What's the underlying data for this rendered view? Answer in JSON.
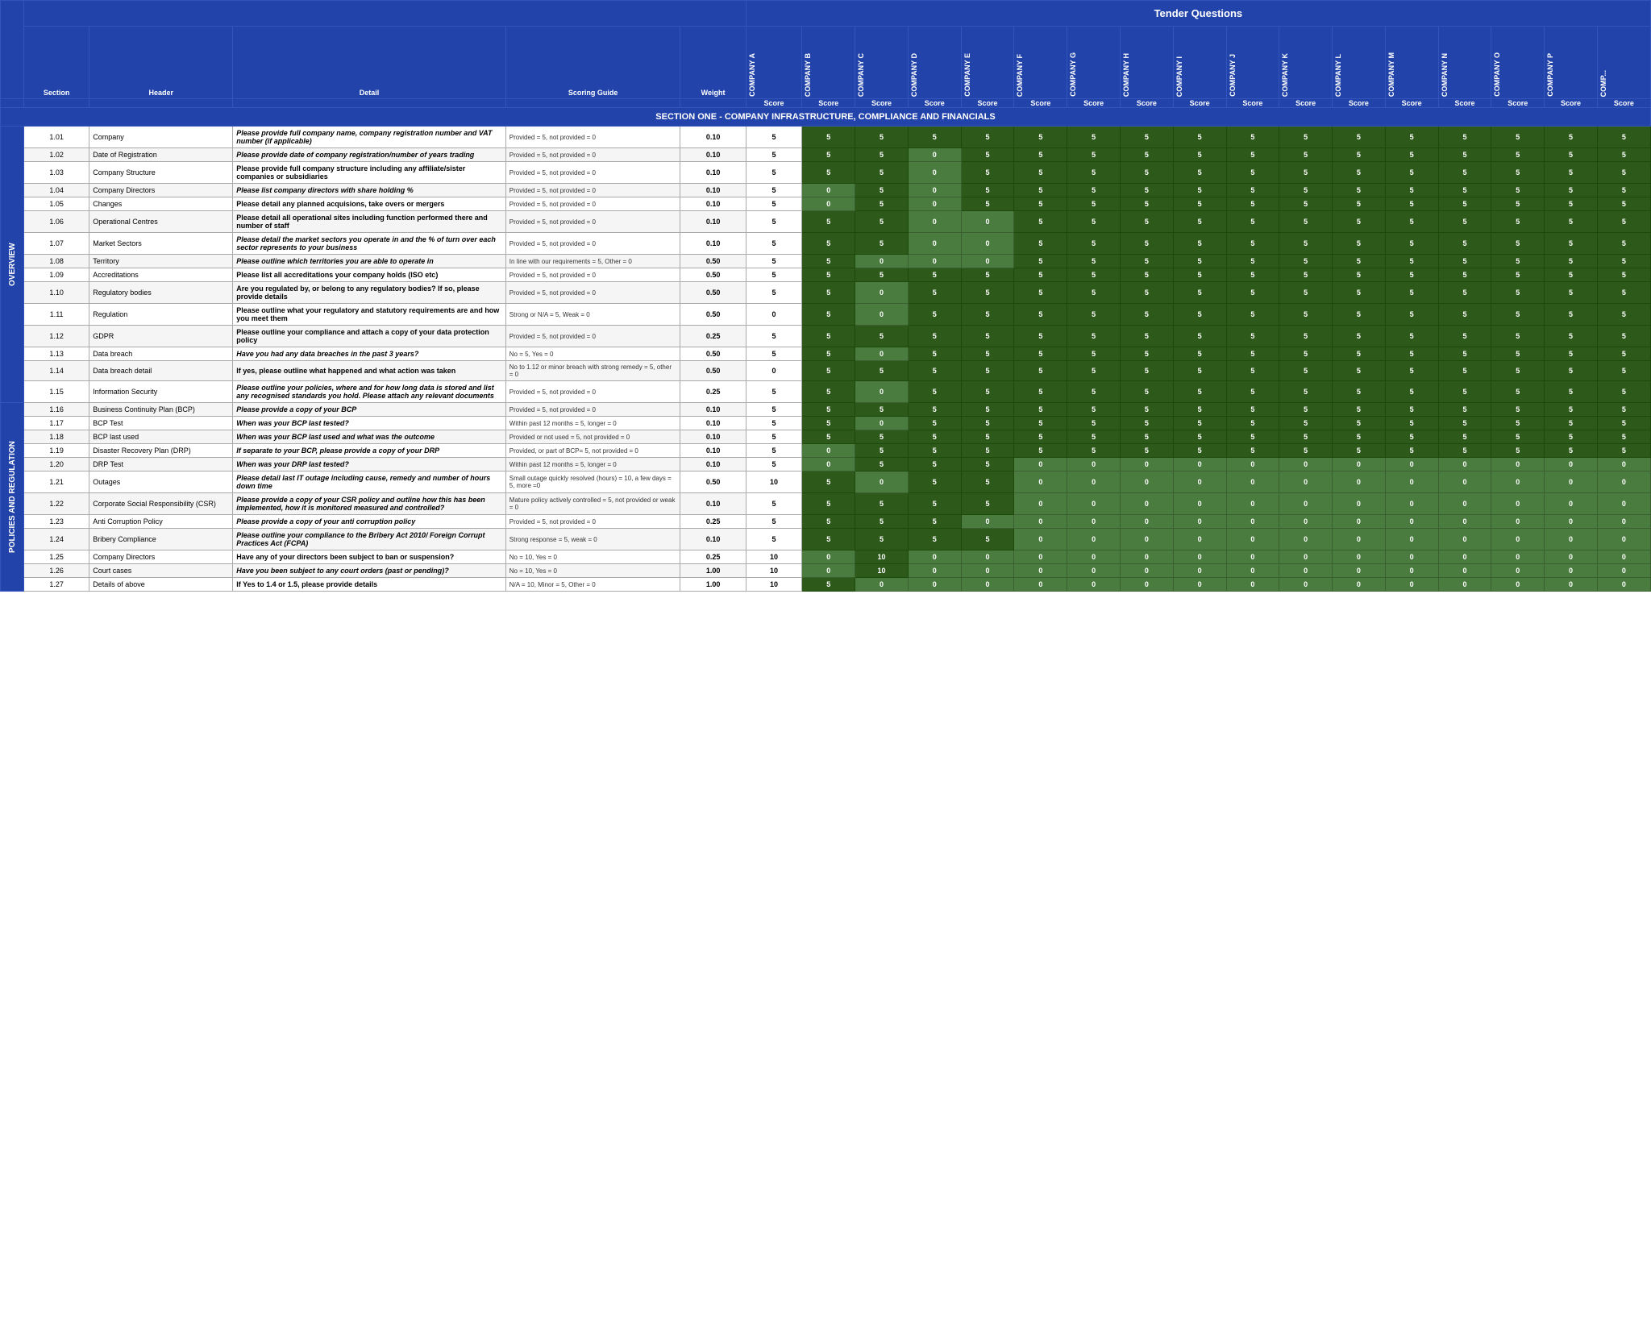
{
  "title": "Tender Questions",
  "section_header": "SECTION ONE - COMPANY INFRASTRUCTURE, COMPLIANCE AND FINANCIALS",
  "col_labels": {
    "section": "Section",
    "header": "Header",
    "detail": "Detail",
    "scoring": "Scoring Guide",
    "weight": "Weight",
    "score": "Score"
  },
  "companies": [
    "COMPANY A",
    "COMPANY B",
    "COMPANY C",
    "COMPANY D",
    "COMPANY E",
    "COMPANY F",
    "COMPANY G",
    "COMPANY H",
    "COMPANY I",
    "COMPANY J",
    "COMPANY K",
    "COMPANY L",
    "COMPANY M",
    "COMPANY N",
    "COMPANY O",
    "COMPANY P",
    "COMP..."
  ],
  "side_labels": {
    "overview": "OVERVIEW",
    "policies": "POLICIES AND REGULATION"
  },
  "rows": [
    {
      "num": "1.01",
      "header": "Company",
      "detail": "Please provide full company name, company registration number and VAT number (if applicable)",
      "scoring": "Provided = 5, not provided = 0",
      "weight": "0.10",
      "scores": [
        5,
        5,
        5,
        5,
        5,
        5,
        5,
        5,
        5,
        5,
        5,
        5,
        5,
        5,
        5,
        5,
        5
      ],
      "detail_bold": true
    },
    {
      "num": "1.02",
      "header": "Date of Registration",
      "detail": "Please provide date of company registration/number of years trading",
      "scoring": "Provided = 5, not provided = 0",
      "weight": "0.10",
      "scores": [
        5,
        5,
        5,
        0,
        5,
        5,
        5,
        5,
        5,
        5,
        5,
        5,
        5,
        5,
        5,
        5,
        5
      ],
      "detail_bold": true
    },
    {
      "num": "1.03",
      "header": "Company Structure",
      "detail": "Please provide full company structure including any affiliate/sister companies or subsidiaries",
      "scoring": "Provided = 5, not provided = 0",
      "weight": "0.10",
      "scores": [
        5,
        5,
        5,
        0,
        5,
        5,
        5,
        5,
        5,
        5,
        5,
        5,
        5,
        5,
        5,
        5,
        5
      ],
      "detail_bold": false
    },
    {
      "num": "1.04",
      "header": "Company Directors",
      "detail": "Please list company directors with share holding %",
      "scoring": "Provided = 5, not provided = 0",
      "weight": "0.10",
      "scores": [
        5,
        0,
        5,
        0,
        5,
        5,
        5,
        5,
        5,
        5,
        5,
        5,
        5,
        5,
        5,
        5,
        5
      ],
      "detail_bold": true
    },
    {
      "num": "1.05",
      "header": "Changes",
      "detail": "Please detail any planned acquisions, take overs or mergers",
      "scoring": "Provided = 5, not provided = 0",
      "weight": "0.10",
      "scores": [
        5,
        0,
        5,
        0,
        5,
        5,
        5,
        5,
        5,
        5,
        5,
        5,
        5,
        5,
        5,
        5,
        5
      ],
      "detail_bold": false
    },
    {
      "num": "1.06",
      "header": "Operational Centres",
      "detail": "Please detail all operational sites including function performed there and number of staff",
      "scoring": "Provided = 5, not provided = 0",
      "weight": "0.10",
      "scores": [
        5,
        5,
        5,
        0,
        0,
        5,
        5,
        5,
        5,
        5,
        5,
        5,
        5,
        5,
        5,
        5,
        5
      ],
      "detail_bold": false
    },
    {
      "num": "1.07",
      "header": "Market Sectors",
      "detail": "Please detail the market sectors you operate in and the % of turn over each sector represents to your business",
      "scoring": "Provided = 5, not provided = 0",
      "weight": "0.10",
      "scores": [
        5,
        5,
        5,
        0,
        0,
        5,
        5,
        5,
        5,
        5,
        5,
        5,
        5,
        5,
        5,
        5,
        5
      ],
      "detail_bold": true
    },
    {
      "num": "1.08",
      "header": "Territory",
      "detail": "Please outline which territories you are able to operate in",
      "scoring": "In line with our requirements = 5, Other = 0",
      "weight": "0.50",
      "scores": [
        5,
        5,
        0,
        0,
        0,
        5,
        5,
        5,
        5,
        5,
        5,
        5,
        5,
        5,
        5,
        5,
        5
      ],
      "detail_bold": true
    },
    {
      "num": "1.09",
      "header": "Accreditations",
      "detail": "Please list all accreditations your company holds (ISO etc)",
      "scoring": "Provided = 5, not provided = 0",
      "weight": "0.50",
      "scores": [
        5,
        5,
        5,
        5,
        5,
        5,
        5,
        5,
        5,
        5,
        5,
        5,
        5,
        5,
        5,
        5,
        5
      ],
      "detail_bold": false
    },
    {
      "num": "1.10",
      "header": "Regulatory bodies",
      "detail": "Are you regulated by, or belong to any regulatory bodies? If so, please provide details",
      "scoring": "Provided = 5, not provided = 0",
      "weight": "0.50",
      "scores": [
        5,
        5,
        0,
        5,
        5,
        5,
        5,
        5,
        5,
        5,
        5,
        5,
        5,
        5,
        5,
        5,
        5
      ],
      "detail_bold": false
    },
    {
      "num": "1.11",
      "header": "Regulation",
      "detail": "Please outline what your regulatory and statutory requirements are and how you meet them",
      "scoring": "Strong or N/A = 5, Weak = 0",
      "weight": "0.50",
      "scores": [
        0,
        5,
        0,
        5,
        5,
        5,
        5,
        5,
        5,
        5,
        5,
        5,
        5,
        5,
        5,
        5,
        5
      ],
      "detail_bold": false
    },
    {
      "num": "1.12",
      "header": "GDPR",
      "detail": "Please outline your compliance and attach a copy of your data protection policy",
      "scoring": "Provided = 5, not provided = 0",
      "weight": "0.25",
      "scores": [
        5,
        5,
        5,
        5,
        5,
        5,
        5,
        5,
        5,
        5,
        5,
        5,
        5,
        5,
        5,
        5,
        5
      ],
      "detail_bold": false
    },
    {
      "num": "1.13",
      "header": "Data breach",
      "detail": "Have you had any data breaches in the past 3 years?",
      "scoring": "No = 5, Yes = 0",
      "weight": "0.50",
      "scores": [
        5,
        5,
        0,
        5,
        5,
        5,
        5,
        5,
        5,
        5,
        5,
        5,
        5,
        5,
        5,
        5,
        5
      ],
      "detail_bold": true
    },
    {
      "num": "1.14",
      "header": "Data breach detail",
      "detail": "If yes, please outline what happened and what action was taken",
      "scoring": "No to 1.12 or minor breach with strong remedy = 5, other = 0",
      "weight": "0.50",
      "scores": [
        0,
        5,
        5,
        5,
        5,
        5,
        5,
        5,
        5,
        5,
        5,
        5,
        5,
        5,
        5,
        5,
        5
      ],
      "detail_bold": false
    },
    {
      "num": "1.15",
      "header": "Information Security",
      "detail": "Please outline your policies, where and for how long data is stored and list any recognised standards you hold. Please attach any relevant documents",
      "scoring": "Provided = 5, not provided = 0",
      "weight": "0.25",
      "scores": [
        5,
        5,
        0,
        5,
        5,
        5,
        5,
        5,
        5,
        5,
        5,
        5,
        5,
        5,
        5,
        5,
        5
      ],
      "detail_bold": true
    },
    {
      "num": "1.16",
      "header": "Business Continuity Plan (BCP)",
      "detail": "Please provide a copy of your BCP",
      "scoring": "Provided = 5, not provided = 0",
      "weight": "0.10",
      "scores": [
        5,
        5,
        5,
        5,
        5,
        5,
        5,
        5,
        5,
        5,
        5,
        5,
        5,
        5,
        5,
        5,
        5
      ],
      "detail_bold": true
    },
    {
      "num": "1.17",
      "header": "BCP Test",
      "detail": "When was your BCP last tested?",
      "scoring": "Within past 12 months = 5, longer = 0",
      "weight": "0.10",
      "scores": [
        5,
        5,
        0,
        5,
        5,
        5,
        5,
        5,
        5,
        5,
        5,
        5,
        5,
        5,
        5,
        5,
        5
      ],
      "detail_bold": true
    },
    {
      "num": "1.18",
      "header": "BCP last used",
      "detail": "When was your BCP last used and what was the outcome",
      "scoring": "Provided or not used = 5, not provided = 0",
      "weight": "0.10",
      "scores": [
        5,
        5,
        5,
        5,
        5,
        5,
        5,
        5,
        5,
        5,
        5,
        5,
        5,
        5,
        5,
        5,
        5
      ],
      "detail_bold": true
    },
    {
      "num": "1.19",
      "header": "Disaster Recovery Plan (DRP)",
      "detail": "If separate to your BCP, please provide a copy of your DRP",
      "scoring": "Provided, or part of BCP= 5, not provided = 0",
      "weight": "0.10",
      "scores": [
        5,
        0,
        5,
        5,
        5,
        5,
        5,
        5,
        5,
        5,
        5,
        5,
        5,
        5,
        5,
        5,
        5
      ],
      "detail_bold": true
    },
    {
      "num": "1.20",
      "header": "DRP Test",
      "detail": "When was your DRP last tested?",
      "scoring": "Within past 12 months = 5, longer = 0",
      "weight": "0.10",
      "scores": [
        5,
        0,
        5,
        5,
        5,
        0,
        0,
        0,
        0,
        0,
        0,
        0,
        0,
        0,
        0,
        0,
        0
      ],
      "detail_bold": true
    },
    {
      "num": "1.21",
      "header": "Outages",
      "detail": "Please detail last IT outage including cause, remedy and number of hours down time",
      "scoring": "Small outage quickly resolved (hours) = 10, a few days = 5, more =0",
      "weight": "0.50",
      "scores": [
        10,
        5,
        0,
        5,
        5,
        0,
        0,
        0,
        0,
        0,
        0,
        0,
        0,
        0,
        0,
        0,
        0
      ],
      "detail_bold": true
    },
    {
      "num": "1.22",
      "header": "Corporate Social Responsibility (CSR)",
      "detail": "Please provide a copy of your CSR policy and outline how this has been implemented, how it is monitored measured and controlled?",
      "scoring": "Mature policy actively controlled = 5, not provided or weak = 0",
      "weight": "0.10",
      "scores": [
        5,
        5,
        5,
        5,
        5,
        0,
        0,
        0,
        0,
        0,
        0,
        0,
        0,
        0,
        0,
        0,
        0
      ],
      "detail_bold": true
    },
    {
      "num": "1.23",
      "header": "Anti Corruption Policy",
      "detail": "Please provide a copy of your anti corruption policy",
      "scoring": "Provided = 5, not provided = 0",
      "weight": "0.25",
      "scores": [
        5,
        5,
        5,
        5,
        0,
        0,
        0,
        0,
        0,
        0,
        0,
        0,
        0,
        0,
        0,
        0,
        0
      ],
      "detail_bold": true
    },
    {
      "num": "1.24",
      "header": "Bribery Compliance",
      "detail": "Please outline your compliance to the Bribery Act 2010/ Foreign Corrupt Practices Act (FCPA)",
      "scoring": "Strong response = 5, weak = 0",
      "weight": "0.10",
      "scores": [
        5,
        5,
        5,
        5,
        5,
        0,
        0,
        0,
        0,
        0,
        0,
        0,
        0,
        0,
        0,
        0,
        0
      ],
      "detail_bold": true
    },
    {
      "num": "1.25",
      "header": "Company Directors",
      "detail": "Have any of your directors been subject to ban or suspension?",
      "scoring": "No = 10, Yes = 0",
      "weight": "0.25",
      "scores": [
        10,
        0,
        10,
        0,
        0,
        0,
        0,
        0,
        0,
        0,
        0,
        0,
        0,
        0,
        0,
        0,
        0
      ],
      "detail_bold": false
    },
    {
      "num": "1.26",
      "header": "Court cases",
      "detail": "Have you been subject to any court orders (past or pending)?",
      "scoring": "No = 10, Yes = 0",
      "weight": "1.00",
      "scores": [
        10,
        0,
        10,
        0,
        0,
        0,
        0,
        0,
        0,
        0,
        0,
        0,
        0,
        0,
        0,
        0,
        0
      ],
      "detail_bold": true
    },
    {
      "num": "1.27",
      "header": "Details of above",
      "detail": "If Yes to 1.4 or 1.5, please provide details",
      "scoring": "N/A = 10, Minor = 5, Other = 0",
      "weight": "1.00",
      "scores": [
        10,
        5,
        0,
        0,
        0,
        0,
        0,
        0,
        0,
        0,
        0,
        0,
        0,
        0,
        0,
        0,
        0
      ],
      "detail_bold": false
    }
  ]
}
